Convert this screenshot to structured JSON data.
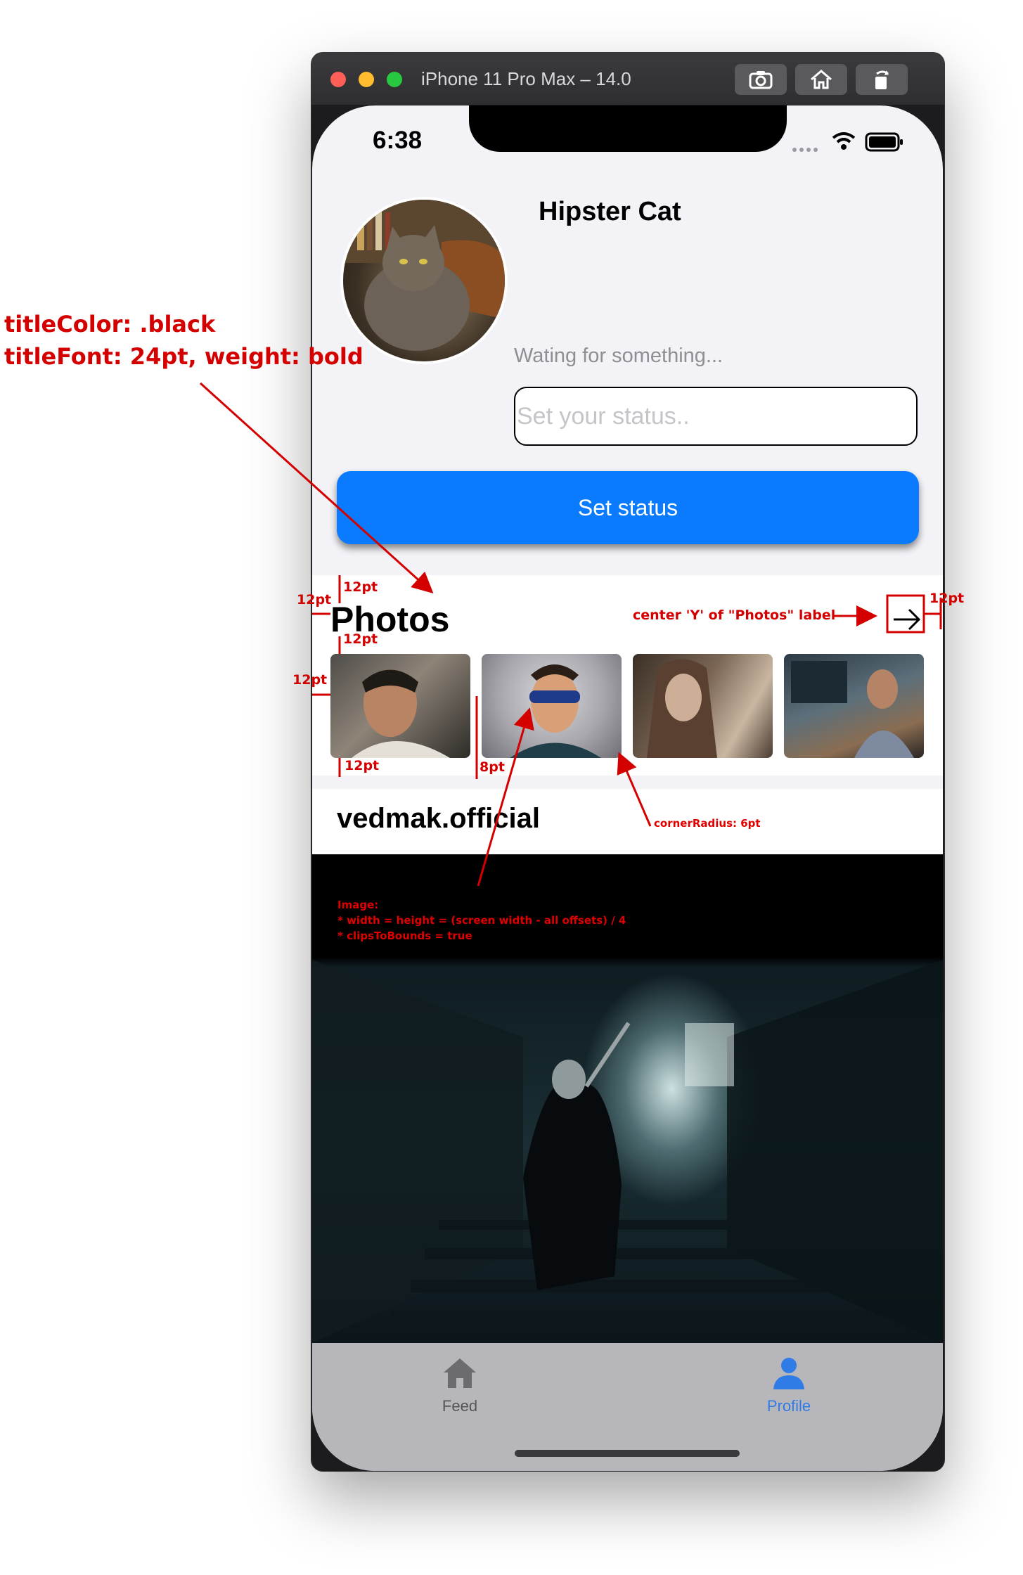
{
  "simulator": {
    "title": "iPhone 11 Pro Max – 14.0",
    "toolbar_icons": [
      "camera-icon",
      "home-icon",
      "rotate-icon"
    ]
  },
  "status_bar": {
    "time": "6:38"
  },
  "profile": {
    "name": "Hipster Cat",
    "status": "Wating for something...",
    "status_placeholder": "Set your status..",
    "button_label": "Set status"
  },
  "photos": {
    "title": "Photos",
    "arrow_icon": "arrow-right-icon"
  },
  "post": {
    "author": "vedmak.official"
  },
  "tab_bar": {
    "items": [
      {
        "label": "Feed",
        "icon": "home-icon",
        "color": "#555559"
      },
      {
        "label": "Profile",
        "icon": "person-icon",
        "color": "#2f7ce6"
      }
    ]
  },
  "annotations": {
    "title_spec_line1": "titleColor: .black",
    "title_spec_line2": "titleFont: 24pt, weight: bold",
    "center_note": "center 'Y' of \"Photos\" label",
    "corner_note": "cornerRadius: 6pt",
    "image_note_line1": "Image:",
    "image_note_line2": "* width = height = (screen width - all offsets) / 4",
    "image_note_line3": "* clipsToBounds = true",
    "offset_12": "12pt",
    "offset_8": "8pt"
  },
  "colors": {
    "accent_blue": "#0a7bff",
    "annotation_red": "#d40000"
  }
}
